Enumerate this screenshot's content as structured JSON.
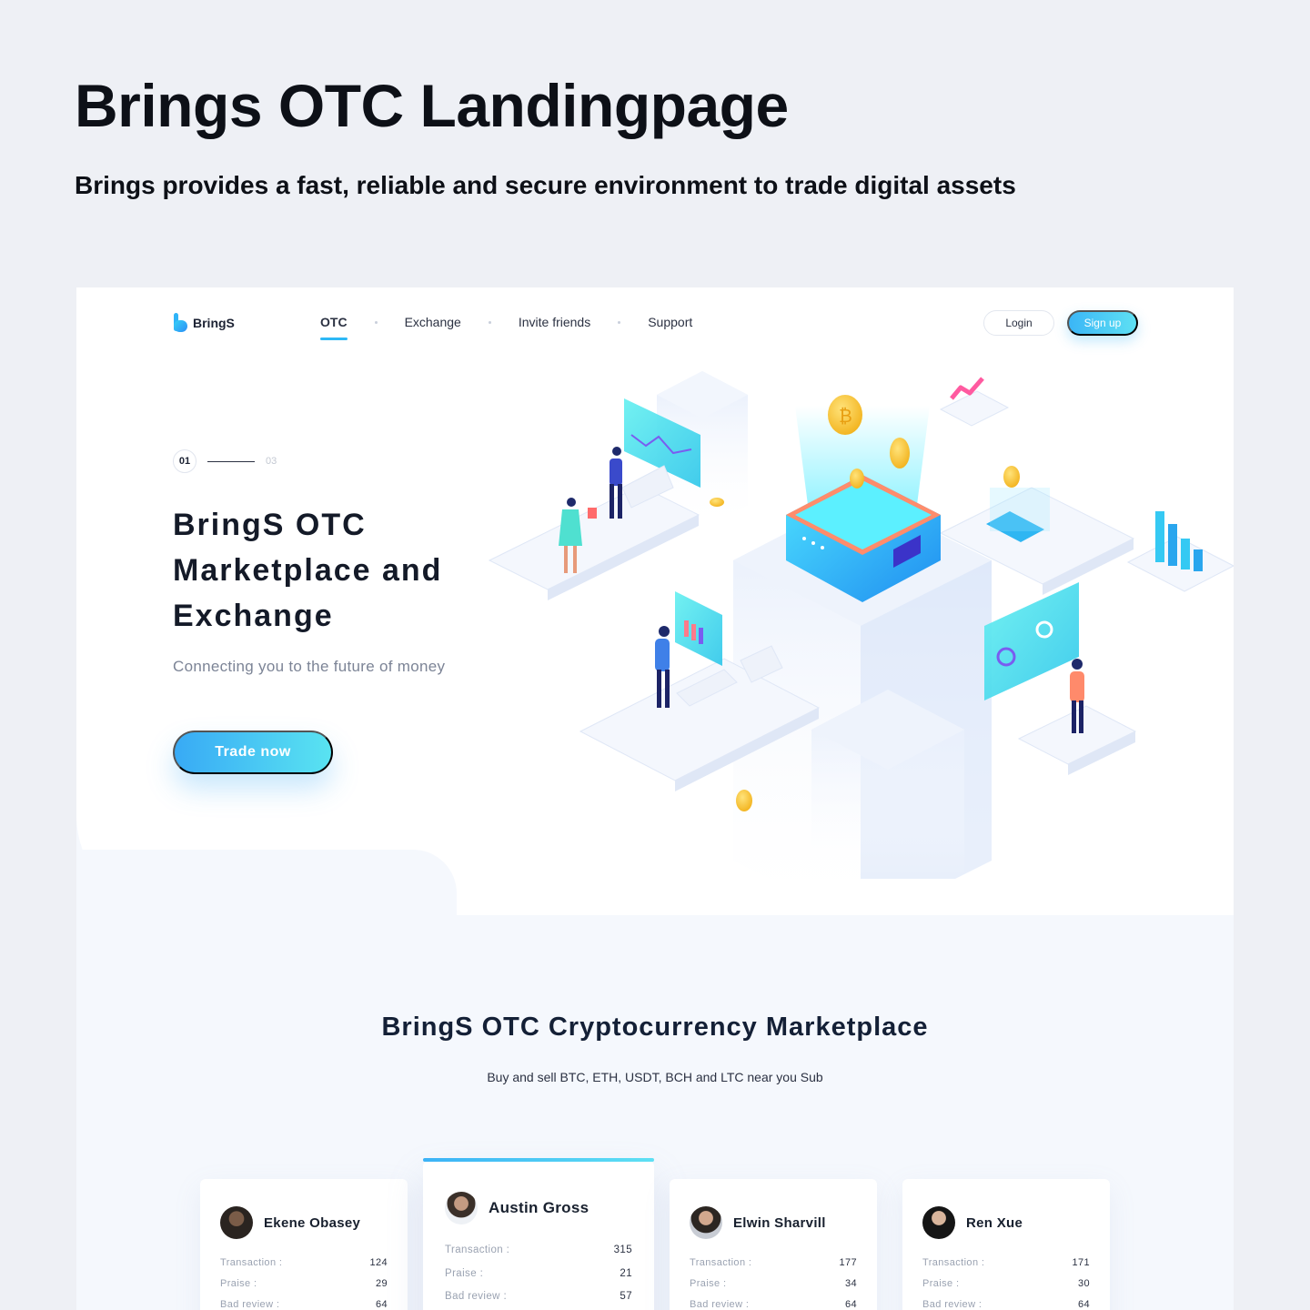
{
  "page": {
    "title": "Brings OTC Landingpage",
    "subtitle": "Brings provides a fast, reliable and secure environment to trade digital assets"
  },
  "nav": {
    "logo": "BringS",
    "items": [
      "OTC",
      "Exchange",
      "Invite friends",
      "Support"
    ],
    "active": "OTC",
    "login": "Login",
    "signup": "Sign up"
  },
  "hero": {
    "pager_current": "01",
    "pager_total": "03",
    "title": "BringS OTC Marketplace and Exchange",
    "subtitle": "Connecting you to the future of money",
    "cta": "Trade now"
  },
  "marketplace": {
    "title": "BringS OTC Cryptocurrency Marketplace",
    "subtitle": "Buy and sell BTC, ETH, USDT, BCH and LTC near you Sub",
    "labels": {
      "transaction": "Transaction :",
      "praise": "Praise :",
      "bad_review": "Bad review :"
    },
    "traders": [
      {
        "name": "Ekene Obasey",
        "transaction": "124",
        "praise": "29",
        "bad_review": "64"
      },
      {
        "name": "Austin Gross",
        "transaction": "315",
        "praise": "21",
        "bad_review": "57"
      },
      {
        "name": "Elwin Sharvill",
        "transaction": "177",
        "praise": "34",
        "bad_review": "64"
      },
      {
        "name": "Ren Xue",
        "transaction": "171",
        "praise": "30",
        "bad_review": "64"
      }
    ]
  },
  "colors": {
    "accent": "#2db8f6",
    "accent_end": "#5ee0f3",
    "background": "#eef0f5",
    "coin": "#f7c52b"
  },
  "icons": [
    "logo-mark-icon",
    "bitcoin-coin-icon",
    "chart-screen-icon",
    "server-box-icon",
    "bar-chart-icon"
  ]
}
